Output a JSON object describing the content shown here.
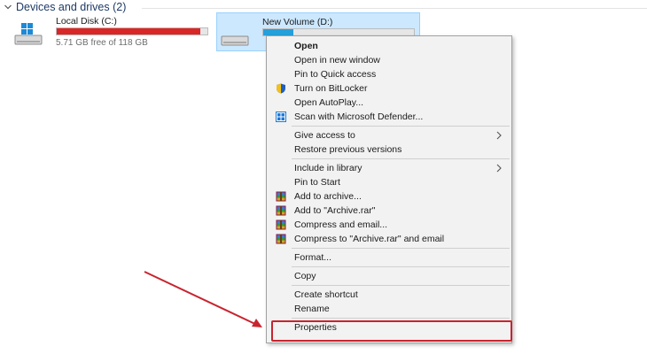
{
  "section": {
    "title": "Devices and drives (2)"
  },
  "drives": [
    {
      "name": "Local Disk (C:)",
      "free_text": "5.71 GB free of 118 GB",
      "fill_fraction": 0.95,
      "fill_color": "#da2626"
    },
    {
      "name": "New Volume (D:)",
      "free_text": "",
      "fill_fraction": 0.2,
      "fill_color": "#26a0da"
    }
  ],
  "context_menu": {
    "items": {
      "open": "Open",
      "open_new_window": "Open in new window",
      "pin_quick_access": "Pin to Quick access",
      "bitlocker": "Turn on BitLocker",
      "autoplay": "Open AutoPlay...",
      "defender": "Scan with Microsoft Defender...",
      "give_access": "Give access to",
      "restore_versions": "Restore previous versions",
      "include_library": "Include in library",
      "pin_start": "Pin to Start",
      "add_archive": "Add to archive...",
      "add_archive_rar": "Add to \"Archive.rar\"",
      "compress_email": "Compress and email...",
      "compress_rar_email": "Compress to \"Archive.rar\" and email",
      "format": "Format...",
      "copy": "Copy",
      "create_shortcut": "Create shortcut",
      "rename": "Rename",
      "properties": "Properties"
    }
  },
  "colors": {
    "highlight": "#c8242f",
    "selection": "#cce8ff"
  },
  "icons": [
    "chevron-down-icon",
    "drive-icon",
    "shield-icon",
    "defender-icon",
    "winrar-icon",
    "chevron-right-icon"
  ]
}
